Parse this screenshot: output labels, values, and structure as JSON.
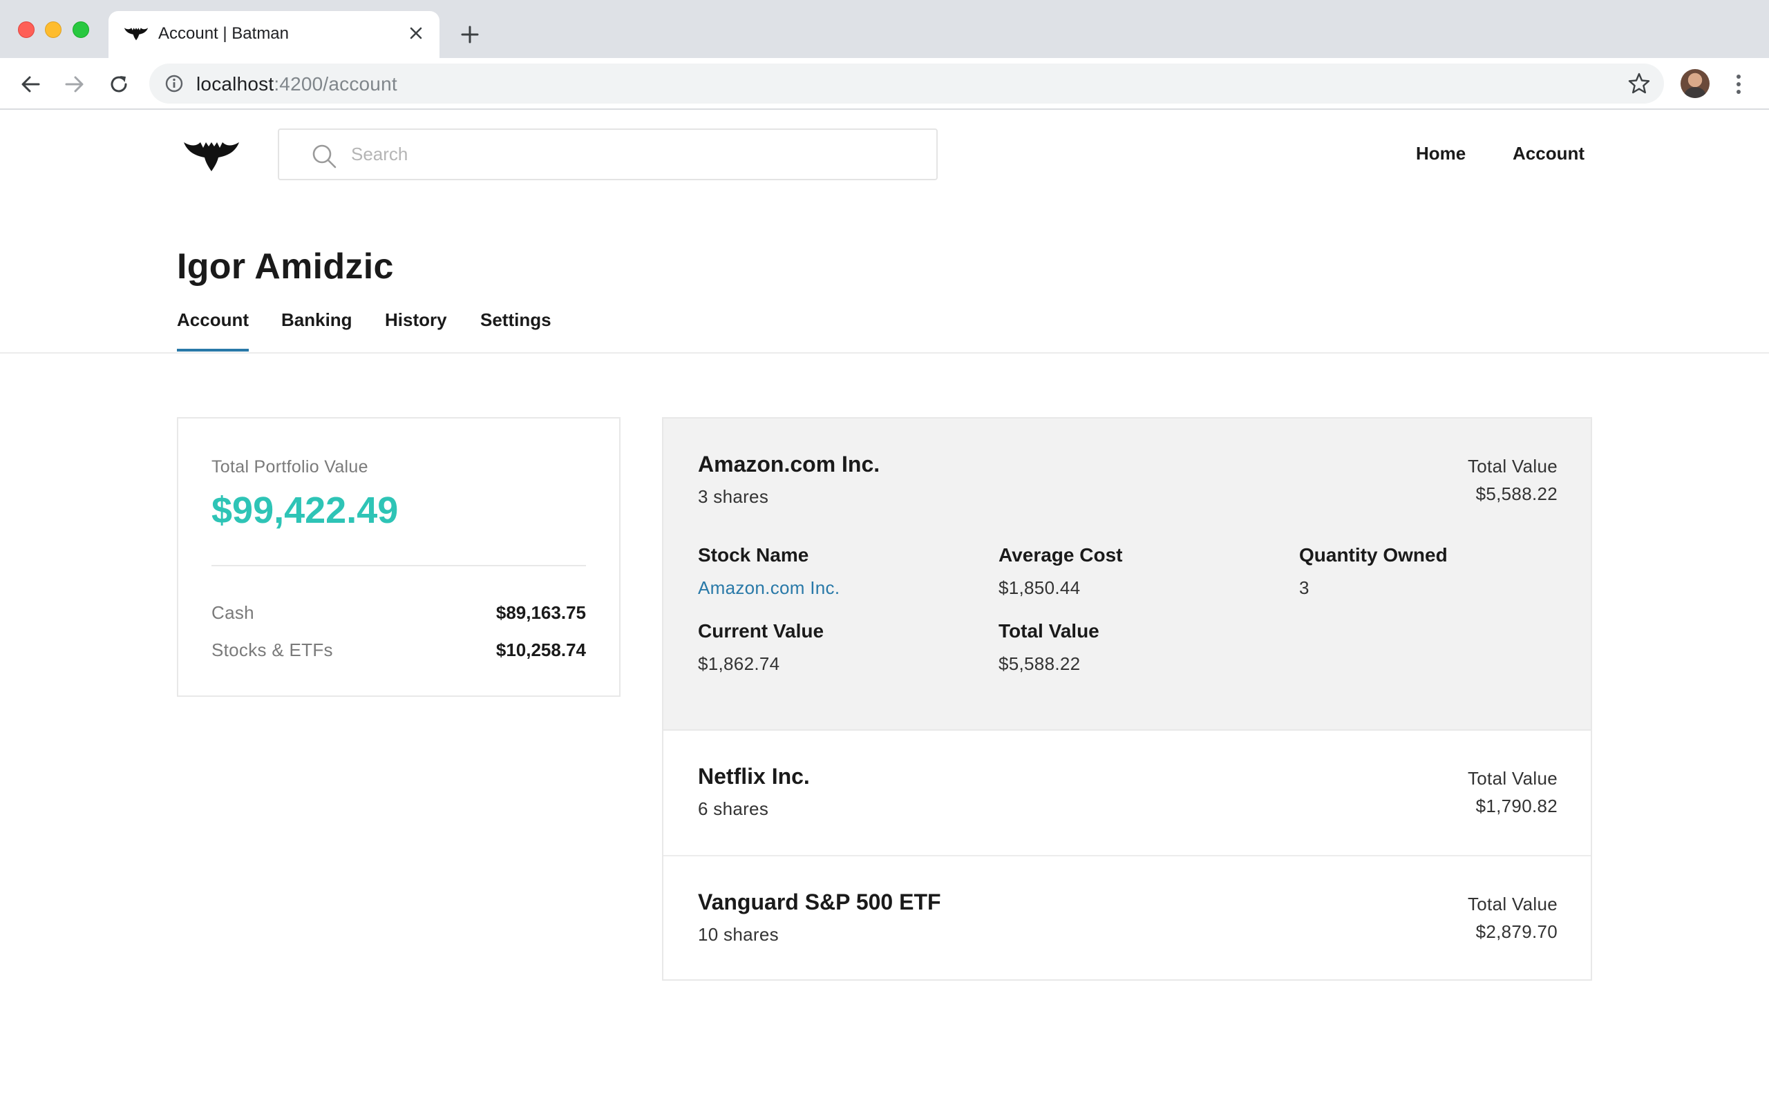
{
  "browser": {
    "tab_title": "Account | Batman",
    "url_host": "localhost",
    "url_path": ":4200/account"
  },
  "header": {
    "search_placeholder": "Search",
    "nav": {
      "home": "Home",
      "account": "Account"
    }
  },
  "user": {
    "name": "Igor Amidzic"
  },
  "subtabs": [
    {
      "label": "Account",
      "active": true
    },
    {
      "label": "Banking",
      "active": false
    },
    {
      "label": "History",
      "active": false
    },
    {
      "label": "Settings",
      "active": false
    }
  ],
  "summary": {
    "label": "Total Portfolio Value",
    "value": "$99,422.49",
    "rows": [
      {
        "label": "Cash",
        "value": "$89,163.75"
      },
      {
        "label": "Stocks & ETFs",
        "value": "$10,258.74"
      }
    ]
  },
  "holdings": [
    {
      "name": "Amazon.com Inc.",
      "shares": "3 shares",
      "total_value_label": "Total Value",
      "total_value": "$5,588.22",
      "expanded": true,
      "details": {
        "stock_name_label": "Stock Name",
        "stock_name": "Amazon.com Inc.",
        "average_cost_label": "Average Cost",
        "average_cost": "$1,850.44",
        "quantity_owned_label": "Quantity Owned",
        "quantity_owned": "3",
        "current_value_label": "Current Value",
        "current_value": "$1,862.74",
        "total_value_label": "Total Value",
        "total_value": "$5,588.22"
      }
    },
    {
      "name": "Netflix Inc.",
      "shares": "6 shares",
      "total_value_label": "Total Value",
      "total_value": "$1,790.82",
      "expanded": false
    },
    {
      "name": "Vanguard S&P 500 ETF",
      "shares": "10 shares",
      "total_value_label": "Total Value",
      "total_value": "$2,879.70",
      "expanded": false
    }
  ],
  "colors": {
    "accent_teal": "#2ec4b6",
    "link_blue": "#2979a8",
    "expanded_bg": "#f2f2f2"
  },
  "icons": [
    "bat-logo-icon",
    "search-icon",
    "back-arrow-icon",
    "forward-arrow-icon",
    "reload-icon",
    "info-icon",
    "star-icon",
    "close-icon",
    "plus-icon",
    "kebab-menu-icon"
  ]
}
